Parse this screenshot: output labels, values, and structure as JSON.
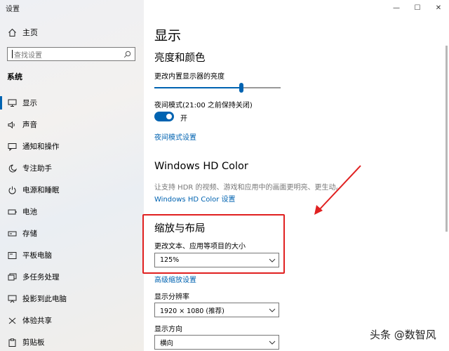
{
  "window": {
    "title": "设置",
    "controls": [
      "—",
      "☐",
      "✕"
    ]
  },
  "sidebar": {
    "home_label": "主页",
    "search_placeholder": "查找设置",
    "section_label": "系统",
    "items": [
      {
        "label": "显示",
        "icon": "monitor-icon",
        "selected": true
      },
      {
        "label": "声音",
        "icon": "speaker-icon",
        "selected": false
      },
      {
        "label": "通知和操作",
        "icon": "message-icon",
        "selected": false
      },
      {
        "label": "专注助手",
        "icon": "moon-icon",
        "selected": false
      },
      {
        "label": "电源和睡眠",
        "icon": "power-icon",
        "selected": false
      },
      {
        "label": "电池",
        "icon": "battery-icon",
        "selected": false
      },
      {
        "label": "存储",
        "icon": "drive-icon",
        "selected": false
      },
      {
        "label": "平板电脑",
        "icon": "tablet-icon",
        "selected": false
      },
      {
        "label": "多任务处理",
        "icon": "multitask-icon",
        "selected": false
      },
      {
        "label": "投影到此电脑",
        "icon": "project-icon",
        "selected": false
      },
      {
        "label": "体验共享",
        "icon": "share-icon",
        "selected": false
      },
      {
        "label": "剪贴板",
        "icon": "clipboard-icon",
        "selected": false
      }
    ]
  },
  "main": {
    "page_title": "显示",
    "brightness": {
      "heading": "亮度和颜色",
      "slider_label": "更改内置显示器的亮度",
      "slider_value": 0.69,
      "night_mode_label": "夜间模式(21:00 之前保持关闭)",
      "toggle_state": "开",
      "night_mode_settings_link": "夜间模式设置"
    },
    "hdr": {
      "heading": "Windows HD Color",
      "description": "让支持 HDR 的视频、游戏和应用中的画面更明亮、更生动。",
      "settings_link": "Windows HD Color 设置"
    },
    "scale": {
      "heading": "缩放与布局",
      "change_size_label": "更改文本、应用等项目的大小",
      "scale_value": "125%",
      "advanced_link": "高级缩放设置",
      "resolution_label": "显示分辨率",
      "resolution_value": "1920 × 1080 (推荐)",
      "orientation_label": "显示方向",
      "orientation_value": "横向"
    }
  },
  "watermark": "头条 @数智风",
  "colors": {
    "accent": "#0063b1",
    "highlight": "#e02020"
  }
}
